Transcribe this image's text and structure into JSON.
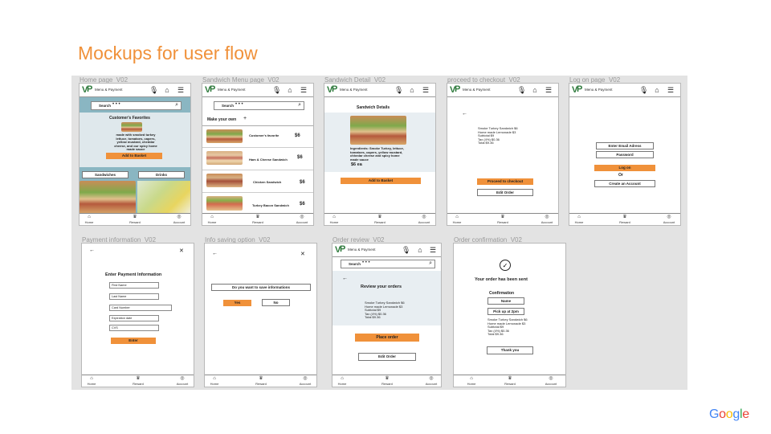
{
  "slide_title": "Mockups for user flow",
  "google_logo": "Google",
  "google_colors": [
    "#4285F4",
    "#EA4335",
    "#FBBC05",
    "#4285F4",
    "#34A853",
    "#EA4335"
  ],
  "accent_color": "#f0913a",
  "app": {
    "header_title": "Menu & Payment",
    "search_label": "Search",
    "search_dots": "• • •",
    "footer": {
      "home": "Home",
      "reward": "Reward",
      "account": "Account"
    },
    "icons": [
      "mic-icon",
      "basket-icon",
      "menu-icon",
      "search-icon",
      "home-icon",
      "reward-icon",
      "account-icon"
    ]
  },
  "screens": {
    "home": {
      "caption": "Home page_V02",
      "favorites_title": "Customer's Favorites",
      "favorites_desc": [
        "made with smoked turkey",
        "lettuce, tomatoes, capers,",
        "yellow mustard, cheddar",
        "cheese, and our spicy home",
        "made sauce"
      ],
      "add_button": "Add to Basket",
      "tab_sandwiches": "Sandwiches",
      "tab_drinks": "Drinks"
    },
    "menu": {
      "caption": "Sandwich Menu page_V02",
      "make_your_own": "Make your own",
      "plus": "+",
      "items": [
        {
          "name": "Customer's favorite",
          "price": "$6"
        },
        {
          "name": "Ham & Cheese Sandwich",
          "price": "$6"
        },
        {
          "name": "Chicken Sandwich",
          "price": "$6"
        },
        {
          "name": "Turkey Bacon Sandwich",
          "price": "$6"
        }
      ]
    },
    "detail": {
      "caption": "Sandwich Detail_V02",
      "title": "Sandwich Details",
      "ingredients": [
        "Ingredients: Smoke Turkey, lettuce,",
        "tomatoes, capers, yellow mustard,",
        "chhedar cheese and spicy home",
        "made sauce"
      ],
      "price": "$6 ea",
      "add_button": "Add to Basket"
    },
    "checkout": {
      "caption": "proceed to checkout_V02",
      "lines": [
        "Smoke Turkey Sandwich $6",
        "Home made Lemonade $3",
        "Subtotal $9",
        "Tax (4%) $0.36",
        "Total $9.36"
      ],
      "proceed_button": "Proceed to checkout",
      "edit_button": "Edit Order"
    },
    "logon": {
      "caption": "Log on page_V02",
      "email": "Enter Email Adress",
      "password": "Password",
      "login_button": "Log on",
      "or": "Or",
      "create_button": "Create an Account"
    },
    "payment": {
      "caption": "Payment information_V02",
      "title": "Enter Payment Information",
      "fields": [
        "First Name",
        "Last Name",
        "Card Number",
        "Expiration date",
        "CVS"
      ],
      "enter_button": "Enter"
    },
    "saving": {
      "caption": "Info saving option_V02",
      "question": "Do you want to save informations",
      "yes": "Yes",
      "no": "No"
    },
    "review": {
      "caption": "Order review_V02",
      "title": "Review your orders",
      "lines": [
        "Smoke Turkey Sandwich $6",
        "Home made Lemonade $3",
        "Subtotal $9",
        "Tax (4%) $0.36",
        "Total $9.36"
      ],
      "place_button": "Place order",
      "edit_button": "Edit Order"
    },
    "confirmation": {
      "caption": "Order confirmation_V02",
      "sent": "Your order has been sent",
      "confirmation": "Confirmation",
      "name": "Name",
      "pickup": "Pick up at 2pm",
      "lines": [
        "Smoke Turkey Sandwich $6",
        "Home made Lemonade $3",
        "Subtotal $9",
        "Tax (4%) $0.36",
        "Total $9.36"
      ],
      "thanks": "Thank you"
    }
  }
}
